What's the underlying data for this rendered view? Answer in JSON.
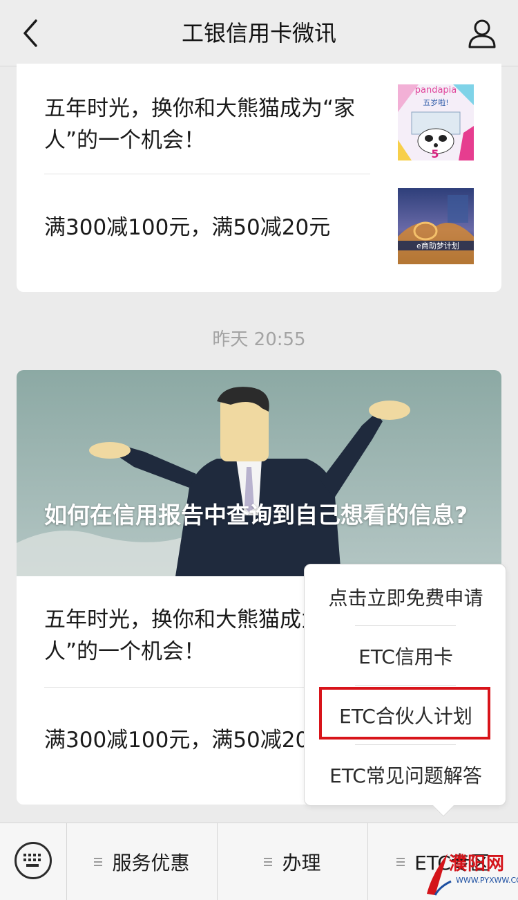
{
  "header": {
    "title": "工银信用卡微讯"
  },
  "card1": {
    "items": [
      {
        "text": "五年时光，换你和大熊猫成为“家人”的一个机会！",
        "thumb_caption": "pandapia",
        "thumb_subcaption": "五岁啦!",
        "thumb_number": "5"
      },
      {
        "text": "满300减100元，满50减20元",
        "thumb_caption": "e商助梦计划"
      }
    ]
  },
  "timestamp": "昨天 20:55",
  "card2": {
    "cover_title": "如何在信用报告中查询到自己想看的信息?",
    "items": [
      {
        "text": "五年时光，换你和大熊猫成为“家人”的一个机会！"
      },
      {
        "text": "满300减100元，满50减20元"
      }
    ]
  },
  "popup": {
    "items": [
      "点击立即免费申请",
      "ETC信用卡",
      "ETC合伙人计划",
      "ETC常见问题解答"
    ],
    "highlighted_index": 2,
    "highlight_color": "#d8141a"
  },
  "bottom_menu": {
    "buttons": [
      "服务优惠",
      "办理",
      "ETC专区"
    ]
  },
  "watermark": {
    "text": "濮阳网",
    "url": "WWW.PYXWW.COM"
  },
  "icons": {
    "back": "chevron-left-icon",
    "profile": "person-icon",
    "keyboard": "keyboard-icon",
    "menu": "menu-lines-icon"
  }
}
